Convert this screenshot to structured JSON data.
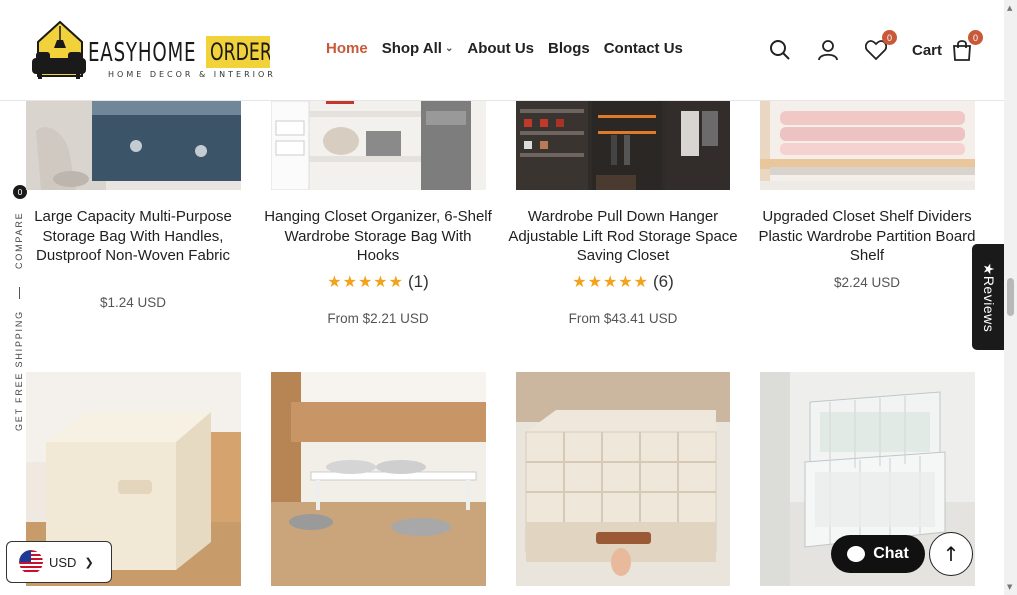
{
  "brand": {
    "name_part1": "EASYHOME",
    "name_part2": "ORDER",
    "tagline": "HOME DECOR & INTERIOR",
    "accent_color": "#f2d23a"
  },
  "nav": {
    "items": [
      {
        "label": "Home",
        "active": true
      },
      {
        "label": "Shop All",
        "has_dropdown": true
      },
      {
        "label": "About Us"
      },
      {
        "label": "Blogs"
      },
      {
        "label": "Contact Us"
      }
    ]
  },
  "header_icons": {
    "search_icon": "search-icon",
    "account_icon": "user-icon",
    "wishlist_count": "0",
    "cart_label": "Cart",
    "cart_count": "0"
  },
  "side": {
    "compare_label": "COMPARE",
    "compare_count": "0",
    "shipping_label": "GET FREE SHIPPING"
  },
  "products_row1": [
    {
      "title": "Large Capacity Multi-Purpose Storage Bag With Handles, Dustproof Non-Woven Fabric",
      "price": "$1.24 USD"
    },
    {
      "title": "Hanging Closet Organizer, 6-Shelf Wardrobe Storage Bag With Hooks",
      "rating_stars": "★★★★★",
      "rating_count": "(1)",
      "price": "From $2.21 USD"
    },
    {
      "title": "Wardrobe Pull Down Hanger Adjustable Lift Rod Storage Space Saving Closet",
      "rating_stars": "★★★★★",
      "rating_count": "(6)",
      "price": "From $43.41 USD"
    },
    {
      "title": "Upgraded Closet Shelf Dividers Plastic Wardrobe Partition Board Shelf",
      "price": "$2.24 USD"
    }
  ],
  "reviews_tab": "★Reviews",
  "currency": {
    "code": "USD"
  },
  "chat": {
    "label": "Chat"
  },
  "colors": {
    "accent": "#c85a3a",
    "star": "#f2a31b"
  }
}
